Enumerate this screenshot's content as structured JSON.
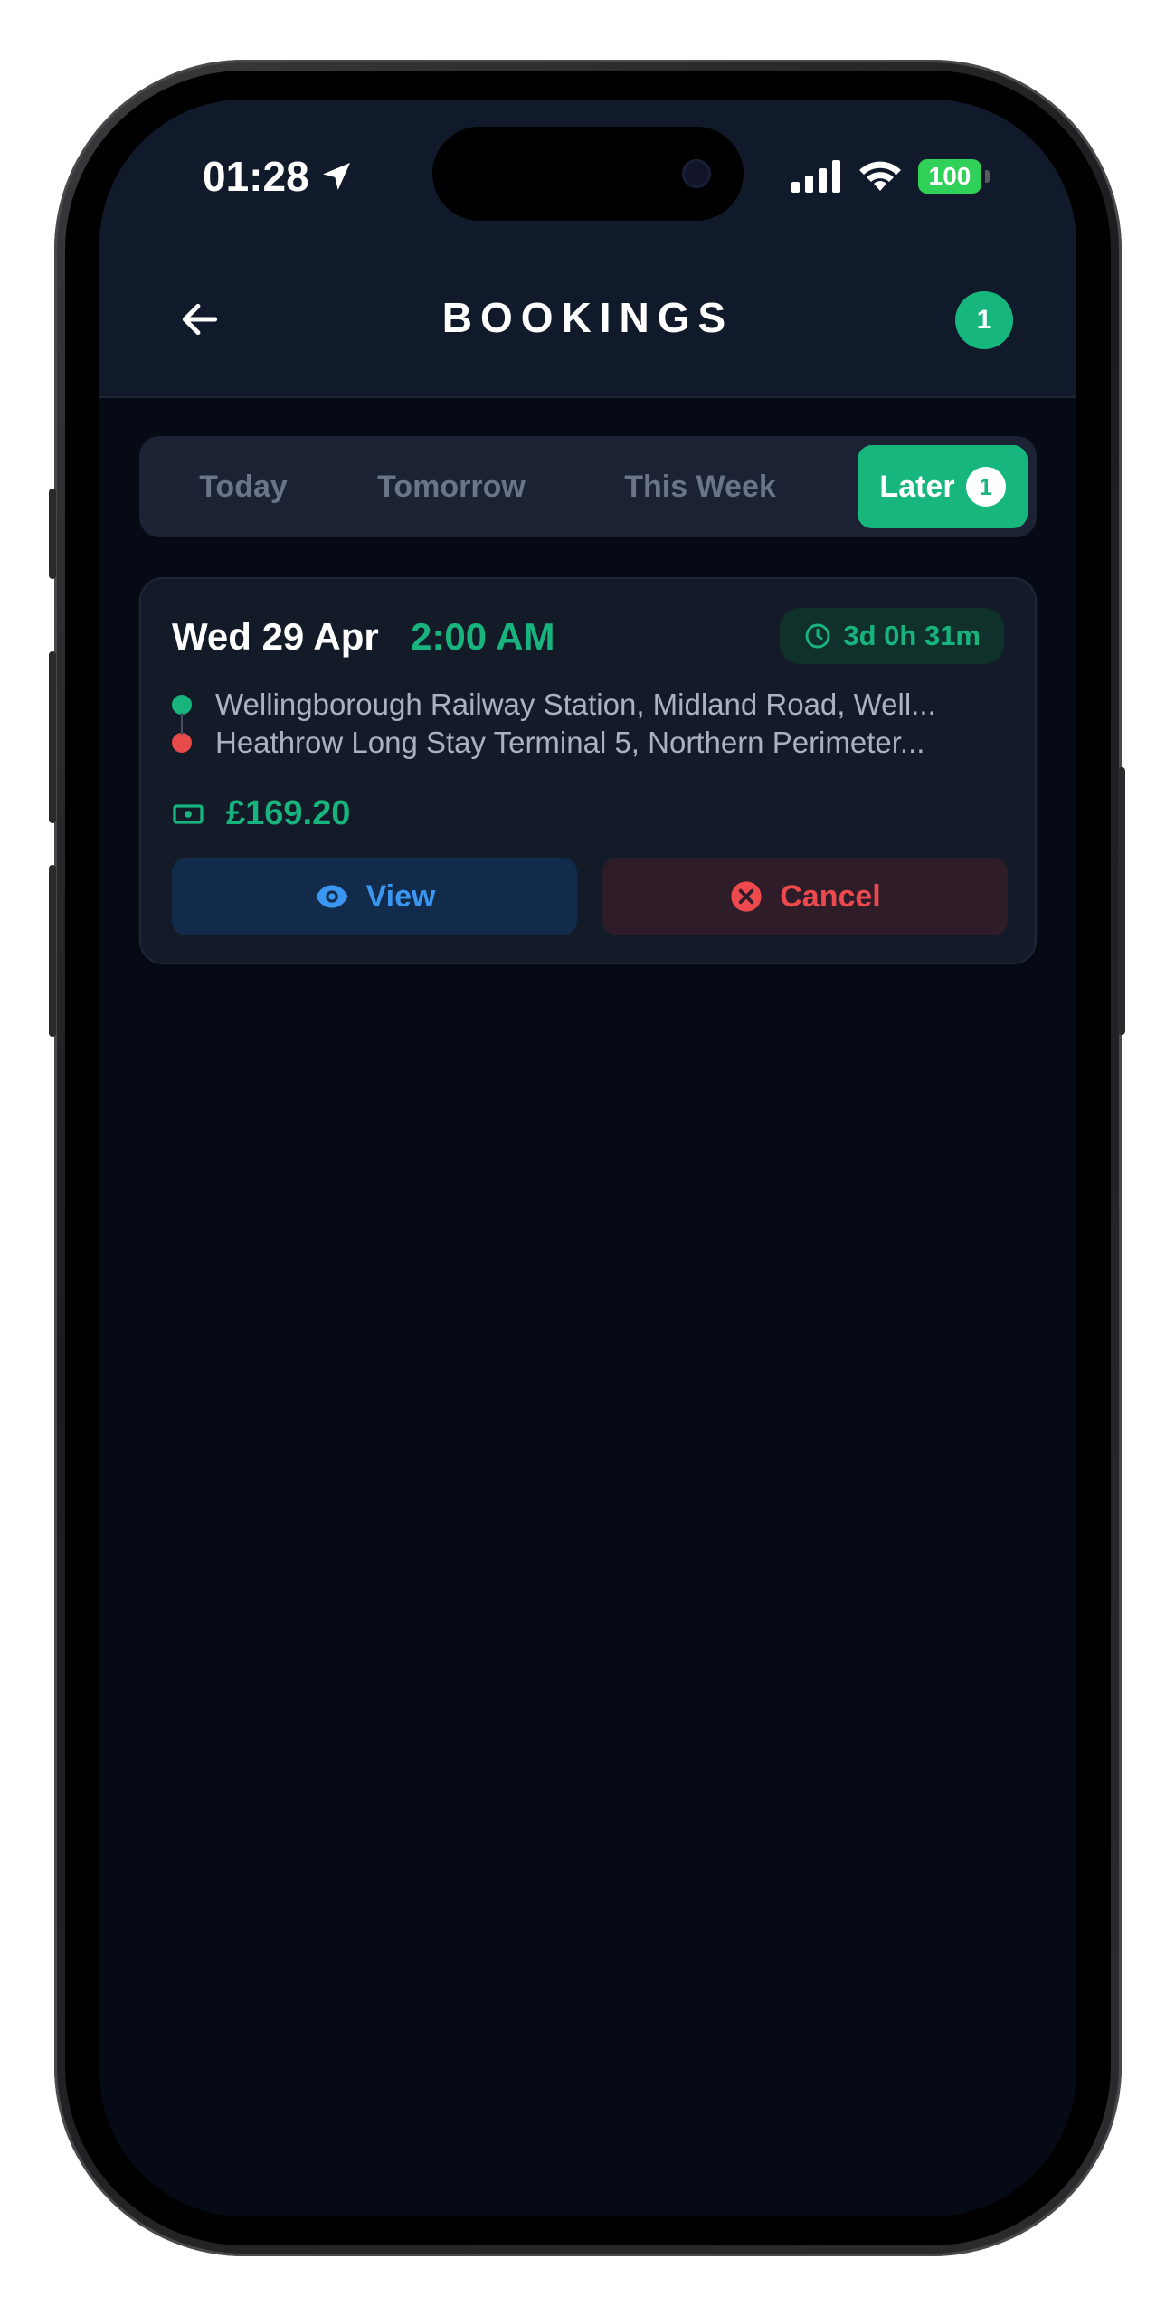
{
  "status_bar": {
    "time": "01:28",
    "battery": "100"
  },
  "header": {
    "title": "BOOKINGS",
    "badge_count": "1"
  },
  "tabs": [
    {
      "label": "Today",
      "active": false
    },
    {
      "label": "Tomorrow",
      "active": false
    },
    {
      "label": "This Week",
      "active": false
    },
    {
      "label": "Later",
      "active": true,
      "count": "1"
    }
  ],
  "booking": {
    "date": "Wed 29 Apr",
    "time": "2:00 AM",
    "countdown": "3d 0h 31m",
    "pickup": "Wellingborough Railway Station, Midland Road, Well...",
    "dropoff": "Heathrow Long Stay Terminal 5, Northern Perimeter...",
    "price": "£169.20",
    "view_label": "View",
    "cancel_label": "Cancel"
  },
  "colors": {
    "accent_green": "#16b67c",
    "danger_red": "#ee4a4e",
    "link_blue": "#3a96f0",
    "background": "#050a14",
    "header_bg": "#111a2a"
  },
  "icons": {
    "back": "arrow-left-icon",
    "location": "location-arrow-icon",
    "clock": "clock-icon",
    "money": "banknote-icon",
    "view": "eye-icon",
    "cancel": "x-circle-icon"
  }
}
